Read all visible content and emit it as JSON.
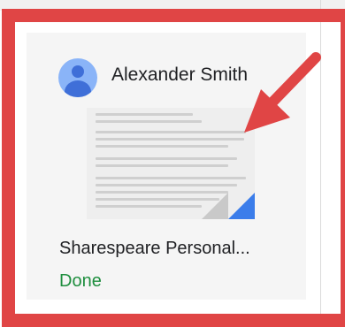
{
  "card": {
    "owner_name": "Alexander Smith",
    "title": "Sharespeare Personal...",
    "status": "Done"
  },
  "icons": {
    "avatar": "person-avatar-icon",
    "annotation": "red-arrow-icon"
  },
  "colors": {
    "highlight": "#e04545",
    "status_done": "#1e8e3e",
    "avatar_bg": "#8ab4f8",
    "avatar_fg": "#3f6fd8",
    "thumbnail_corner": "#3b7dea"
  }
}
